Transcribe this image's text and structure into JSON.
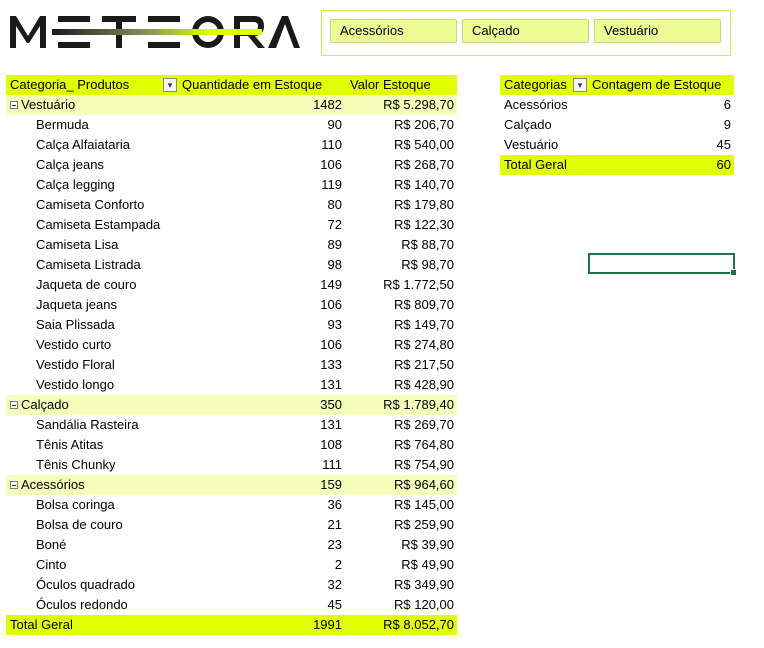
{
  "logo": {
    "text": "METEORA",
    "accent_color": "#e1ff01"
  },
  "slicer": {
    "items": [
      "Acessórios",
      "Calçado",
      "Vestuário"
    ]
  },
  "colors": {
    "header_bg": "#e1ff01",
    "group_bg": "#f6ffba",
    "slicer_btn": "#ecfb93",
    "selection": "#217346"
  },
  "pivot_main": {
    "headers": {
      "category": "Categoria_ Produtos",
      "qty": "Quantidade em Estoque",
      "value": "Valor Estoque"
    },
    "rows": [
      {
        "type": "group",
        "label": "Vestuário",
        "qty": "1482",
        "value": "R$ 5.298,70"
      },
      {
        "type": "item",
        "label": "Bermuda",
        "qty": "90",
        "value": "R$ 206,70"
      },
      {
        "type": "item",
        "label": "Calça Alfaiataria",
        "qty": "110",
        "value": "R$ 540,00"
      },
      {
        "type": "item",
        "label": "Calça jeans",
        "qty": "106",
        "value": "R$ 268,70"
      },
      {
        "type": "item",
        "label": "Calça legging",
        "qty": "119",
        "value": "R$ 140,70"
      },
      {
        "type": "item",
        "label": "Camiseta Conforto",
        "qty": "80",
        "value": "R$ 179,80"
      },
      {
        "type": "item",
        "label": "Camiseta Estampada",
        "qty": "72",
        "value": "R$ 122,30"
      },
      {
        "type": "item",
        "label": "Camiseta Lisa",
        "qty": "89",
        "value": "R$ 88,70"
      },
      {
        "type": "item",
        "label": "Camiseta Listrada",
        "qty": "98",
        "value": "R$ 98,70"
      },
      {
        "type": "item",
        "label": "Jaqueta de couro",
        "qty": "149",
        "value": "R$ 1.772,50"
      },
      {
        "type": "item",
        "label": "Jaqueta jeans",
        "qty": "106",
        "value": "R$ 809,70"
      },
      {
        "type": "item",
        "label": "Saia Plissada",
        "qty": "93",
        "value": "R$ 149,70"
      },
      {
        "type": "item",
        "label": "Vestido curto",
        "qty": "106",
        "value": "R$ 274,80"
      },
      {
        "type": "item",
        "label": "Vestido Floral",
        "qty": "133",
        "value": "R$ 217,50"
      },
      {
        "type": "item",
        "label": "Vestido longo",
        "qty": "131",
        "value": "R$ 428,90"
      },
      {
        "type": "group",
        "label": "Calçado",
        "qty": "350",
        "value": "R$ 1.789,40"
      },
      {
        "type": "item",
        "label": "Sandália Rasteira",
        "qty": "131",
        "value": "R$ 269,70"
      },
      {
        "type": "item",
        "label": "Tênis Atitas",
        "qty": "108",
        "value": "R$ 764,80"
      },
      {
        "type": "item",
        "label": "Tênis Chunky",
        "qty": "111",
        "value": "R$ 754,90"
      },
      {
        "type": "group",
        "label": "Acessórios",
        "qty": "159",
        "value": "R$ 964,60"
      },
      {
        "type": "item",
        "label": "Bolsa coringa",
        "qty": "36",
        "value": "R$ 145,00"
      },
      {
        "type": "item",
        "label": "Bolsa de couro",
        "qty": "21",
        "value": "R$ 259,90"
      },
      {
        "type": "item",
        "label": "Boné",
        "qty": "23",
        "value": "R$ 39,90"
      },
      {
        "type": "item",
        "label": "Cinto",
        "qty": "2",
        "value": "R$ 49,90"
      },
      {
        "type": "item",
        "label": "Óculos quadrado",
        "qty": "32",
        "value": "R$ 349,90"
      },
      {
        "type": "item",
        "label": "Óculos redondo",
        "qty": "45",
        "value": "R$ 120,00"
      }
    ],
    "total": {
      "label": "Total Geral",
      "qty": "1991",
      "value": "R$ 8.052,70"
    }
  },
  "pivot_count": {
    "headers": {
      "category": "Categorias",
      "count": "Contagem de Estoque"
    },
    "rows": [
      {
        "label": "Acessórios",
        "count": "6"
      },
      {
        "label": "Calçado",
        "count": "9"
      },
      {
        "label": "Vestuário",
        "count": "45"
      }
    ],
    "total": {
      "label": "Total Geral",
      "count": "60"
    }
  }
}
